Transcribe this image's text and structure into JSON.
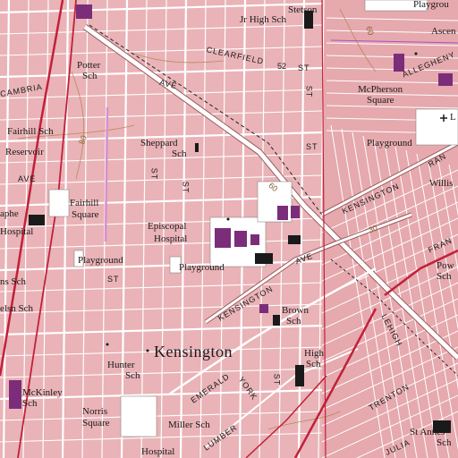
{
  "map": {
    "place_labels": {
      "stetson": "Stetson",
      "jr_high": "Jr High Sch",
      "playground_ne": "Playgrou",
      "potter": "Potter",
      "potter_sch": "Sch",
      "cambria": "CAMBRIA",
      "clearfield": "CLEARFIELD",
      "allegheny": "ALLEGHENY",
      "mcpherson": "McPherson",
      "mcpherson_sq": "Square",
      "playground_mcp": "Playground",
      "fairhill_sch": "Fairhill Sch",
      "reservoir": "Reservoir",
      "sheppard": "Sheppard",
      "sheppard_sch": "Sch",
      "kensington_road": "KENSINGTON",
      "fairhill_sq1": "Fairhill",
      "fairhill_sq2": "Square",
      "episcopal1": "Episcopal",
      "episcopal2": "Hospital",
      "apes_hospital": "Hospital",
      "apes": "aphe",
      "playground_w": "Playground",
      "playground_c": "Playground",
      "kensington_ave": "KENSINGTON",
      "brown": "Brown",
      "brown_sch": "Sch",
      "kensington_big": "Kensington",
      "high": "High",
      "high_sch": "Sch",
      "hunter": "Hunter",
      "hunter_sch": "Sch",
      "mckinley": "McKinley",
      "mckinley_sch": "Sch",
      "norris1": "Norris",
      "norris2": "Square",
      "miller": "Miller Sch",
      "hospital_s": "Hospital",
      "st_annes1": "St Annes",
      "st_annes2": "Sch",
      "trenton": "TRENTON",
      "lehigh": "LEHIGH",
      "emerald": "EMERALD",
      "york": "YORK",
      "lumber": "LUMBER",
      "willis": "Willis",
      "ran": "RAN",
      "fran": "FRAN",
      "pow": "Pow",
      "pow_sch": "Sch",
      "ascension": "Ascen",
      "ans_sch": "ns Sch",
      "elsn_sch": "elsn Sch",
      "frank_l": "L",
      "julia": "JULIA"
    },
    "road_labels": {
      "ave_top": "AVE",
      "st_52": "52",
      "st_top": "ST",
      "st_mid": "ST",
      "st_side": "ST",
      "ave_left": "AVE",
      "ave_mid": "AVE",
      "st_v1": "ST",
      "st_v2": "ST",
      "st_v3": "ST",
      "st_lower": "ST"
    },
    "contour_labels": {
      "c80": "80",
      "c60": "60",
      "c30": "30",
      "c60b": "60"
    },
    "colors": {
      "urban_tint": "#e9b3b7",
      "street": "#ffffff",
      "street_casing": "#9a5a5e",
      "building": "#7b2d7a",
      "park": "#ffffff",
      "highway": "#c2203a",
      "contour": "#b88a5a",
      "rail": "#222222",
      "blue_line": "#b04fc9"
    }
  }
}
